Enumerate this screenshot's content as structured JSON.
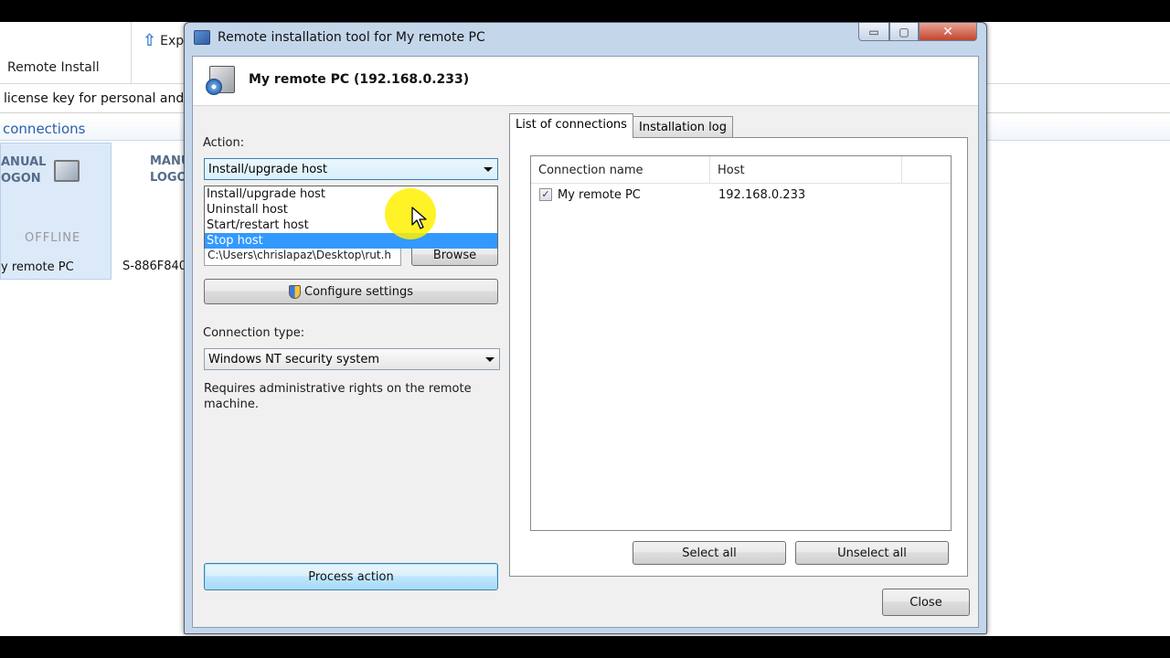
{
  "background": {
    "tab_label": "Remote Install",
    "export_label": "Exp",
    "license_text": "license key for personal and ho",
    "connections_title": "connections",
    "tiles": [
      {
        "top_text_line1": "ANUAL",
        "top_text_line2": "OGON",
        "status": "OFFLINE",
        "name": "y remote PC"
      },
      {
        "top_text_line1": "MANU",
        "top_text_line2": "LOGO",
        "name": "S-886F840"
      }
    ]
  },
  "dialog": {
    "title": "Remote installation tool for My remote PC",
    "window_buttons": {
      "minimize": "▭",
      "maximize": "▢",
      "close": "✕"
    },
    "header_title": "My remote PC (192.168.0.233)",
    "action": {
      "label": "Action:",
      "selected": "Install/upgrade host",
      "options": [
        "Install/upgrade host",
        "Uninstall host",
        "Start/restart host",
        "Stop host"
      ],
      "highlighted_index": 3
    },
    "path_value": "C:\\Users\\chrislapaz\\Desktop\\rut.h",
    "browse_label": "Browse",
    "configure_label": "Configure settings",
    "connection_type": {
      "label": "Connection type:",
      "selected": "Windows NT security system",
      "description": "Requires administrative rights on the remote machine."
    },
    "process_label": "Process action",
    "tabs": [
      "List of connections",
      "Installation log"
    ],
    "active_tab": 0,
    "list": {
      "columns": [
        "Connection name",
        "Host"
      ],
      "rows": [
        {
          "checked": true,
          "check_glyph": "✓",
          "name": "My remote PC",
          "host": "192.168.0.233"
        }
      ]
    },
    "select_all_label": "Select all",
    "unselect_all_label": "Unselect all",
    "close_label": "Close"
  }
}
